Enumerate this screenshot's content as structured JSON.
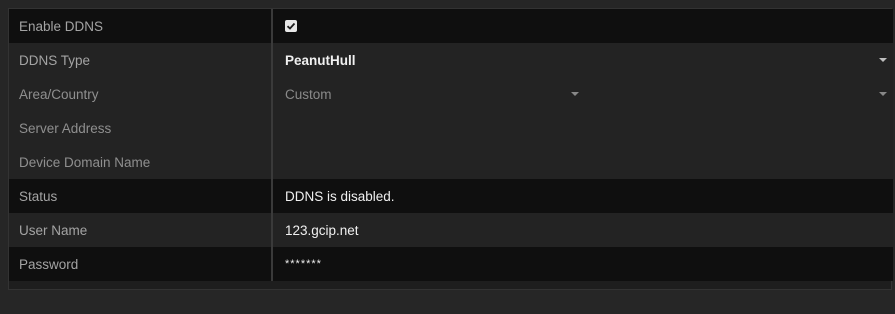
{
  "ddns": {
    "enable": {
      "label": "Enable DDNS",
      "checked": true
    },
    "type": {
      "label": "DDNS Type",
      "value": "PeanutHull"
    },
    "area": {
      "label": "Area/Country",
      "value": "Custom"
    },
    "server": {
      "label": "Server Address",
      "value": ""
    },
    "domain": {
      "label": "Device Domain Name",
      "value": ""
    },
    "status": {
      "label": "Status",
      "value": "DDNS is disabled."
    },
    "username": {
      "label": "User Name",
      "value": "123.gcip.net"
    },
    "password": {
      "label": "Password",
      "value": "*******"
    }
  },
  "icons": {
    "checkbox": "checkmark-icon",
    "dropdown": "chevron-down-icon"
  },
  "colors": {
    "background": "#262626",
    "row_dark": "#0f0f0f",
    "row_mid": "#232323",
    "label_text": "#a4a4a4",
    "value_text": "#f0f0f0"
  }
}
